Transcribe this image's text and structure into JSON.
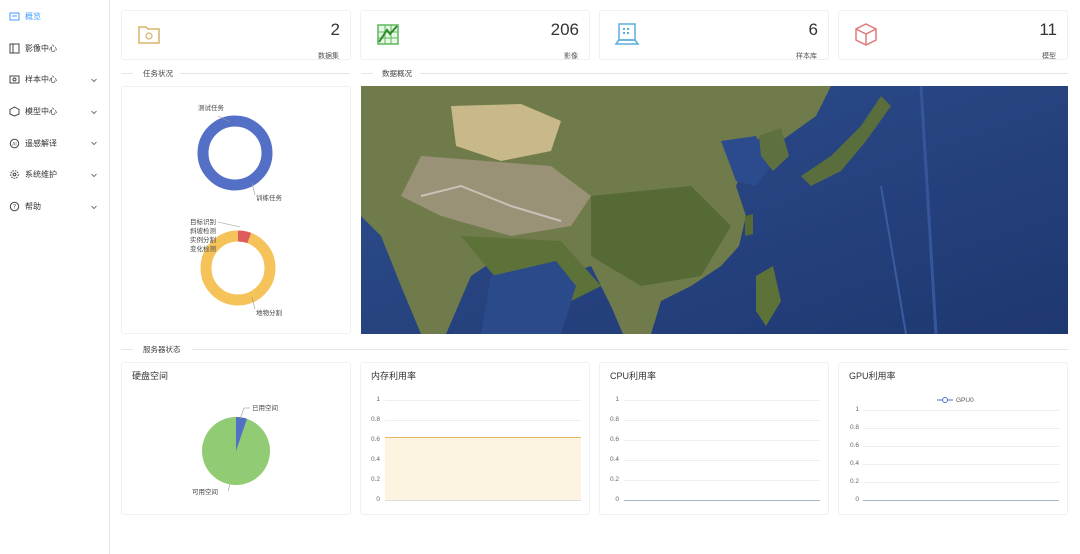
{
  "sidebar": {
    "items": [
      {
        "label": "概览",
        "icon": "overview-icon",
        "active": true
      },
      {
        "label": "影像中心",
        "icon": "image-center-icon"
      },
      {
        "label": "样本中心",
        "icon": "sample-center-icon"
      },
      {
        "label": "模型中心",
        "icon": "model-center-icon"
      },
      {
        "label": "遥感解译",
        "icon": "remote-sensing-icon"
      },
      {
        "label": "系统维护",
        "icon": "gear-icon"
      },
      {
        "label": "帮助",
        "icon": "help-icon"
      }
    ]
  },
  "stats": [
    {
      "value": "2",
      "label": "数据集",
      "icon": "dataset-folder-icon",
      "color": "#d9b46a"
    },
    {
      "value": "206",
      "label": "影像",
      "icon": "image-map-icon",
      "color": "#5cb85c"
    },
    {
      "value": "6",
      "label": "样本库",
      "icon": "sample-library-icon",
      "color": "#5aaed9"
    },
    {
      "value": "11",
      "label": "模型",
      "icon": "model-cube-icon",
      "color": "#e07a7a"
    }
  ],
  "sections": {
    "task_status": "任务状况",
    "data_overview": "数据概况",
    "server_status": "服务器状态"
  },
  "task_donut1": {
    "labels": {
      "test": "测试任务",
      "train": "训练任务"
    },
    "color": "#5470c6"
  },
  "task_donut2": {
    "labels": {
      "target": "目标识别",
      "slope": "斜坡检测",
      "instance": "实例分割",
      "change": "变化检测",
      "landcover": "地物分割"
    },
    "main_color": "#f6c35b",
    "slice_color": "#e05c5c"
  },
  "panels": {
    "disk": {
      "title": "硬盘空间",
      "used_label": "已用空间",
      "free_label": "可用空间",
      "used_color": "#5470c6",
      "free_color": "#91cc75"
    },
    "memory": {
      "title": "内存利用率",
      "ticks": [
        "1",
        "0.8",
        "0.6",
        "0.4",
        "0.2",
        "0"
      ]
    },
    "cpu": {
      "title": "CPU利用率",
      "ticks": [
        "1",
        "0.8",
        "0.6",
        "0.4",
        "0.2",
        "0"
      ]
    },
    "gpu": {
      "title": "GPU利用率",
      "legend": "GPU0",
      "ticks": [
        "1",
        "0.8",
        "0.6",
        "0.4",
        "0.2",
        "0"
      ]
    }
  },
  "chart_data": [
    {
      "type": "pie",
      "title": "",
      "categories": [
        "测试任务",
        "训练任务"
      ],
      "values": [
        0,
        1
      ]
    },
    {
      "type": "pie",
      "title": "",
      "categories": [
        "目标识别",
        "斜坡检测",
        "实例分割",
        "变化检测",
        "地物分割"
      ],
      "values": [
        0,
        0.06,
        0,
        0,
        0.94
      ]
    },
    {
      "type": "pie",
      "title": "硬盘空间",
      "categories": [
        "已用空间",
        "可用空间"
      ],
      "values": [
        0.05,
        0.95
      ]
    },
    {
      "type": "area",
      "title": "内存利用率",
      "ylim": [
        0,
        1
      ],
      "series": [
        {
          "values": [
            0.62,
            0.62
          ]
        }
      ]
    },
    {
      "type": "line",
      "title": "CPU利用率",
      "ylim": [
        0,
        1
      ],
      "series": [
        {
          "values": [
            0,
            0,
            0.005,
            0
          ]
        }
      ]
    },
    {
      "type": "line",
      "title": "GPU利用率",
      "ylim": [
        0,
        1
      ],
      "series": [
        {
          "name": "GPU0",
          "values": [
            0,
            0
          ]
        }
      ]
    }
  ]
}
